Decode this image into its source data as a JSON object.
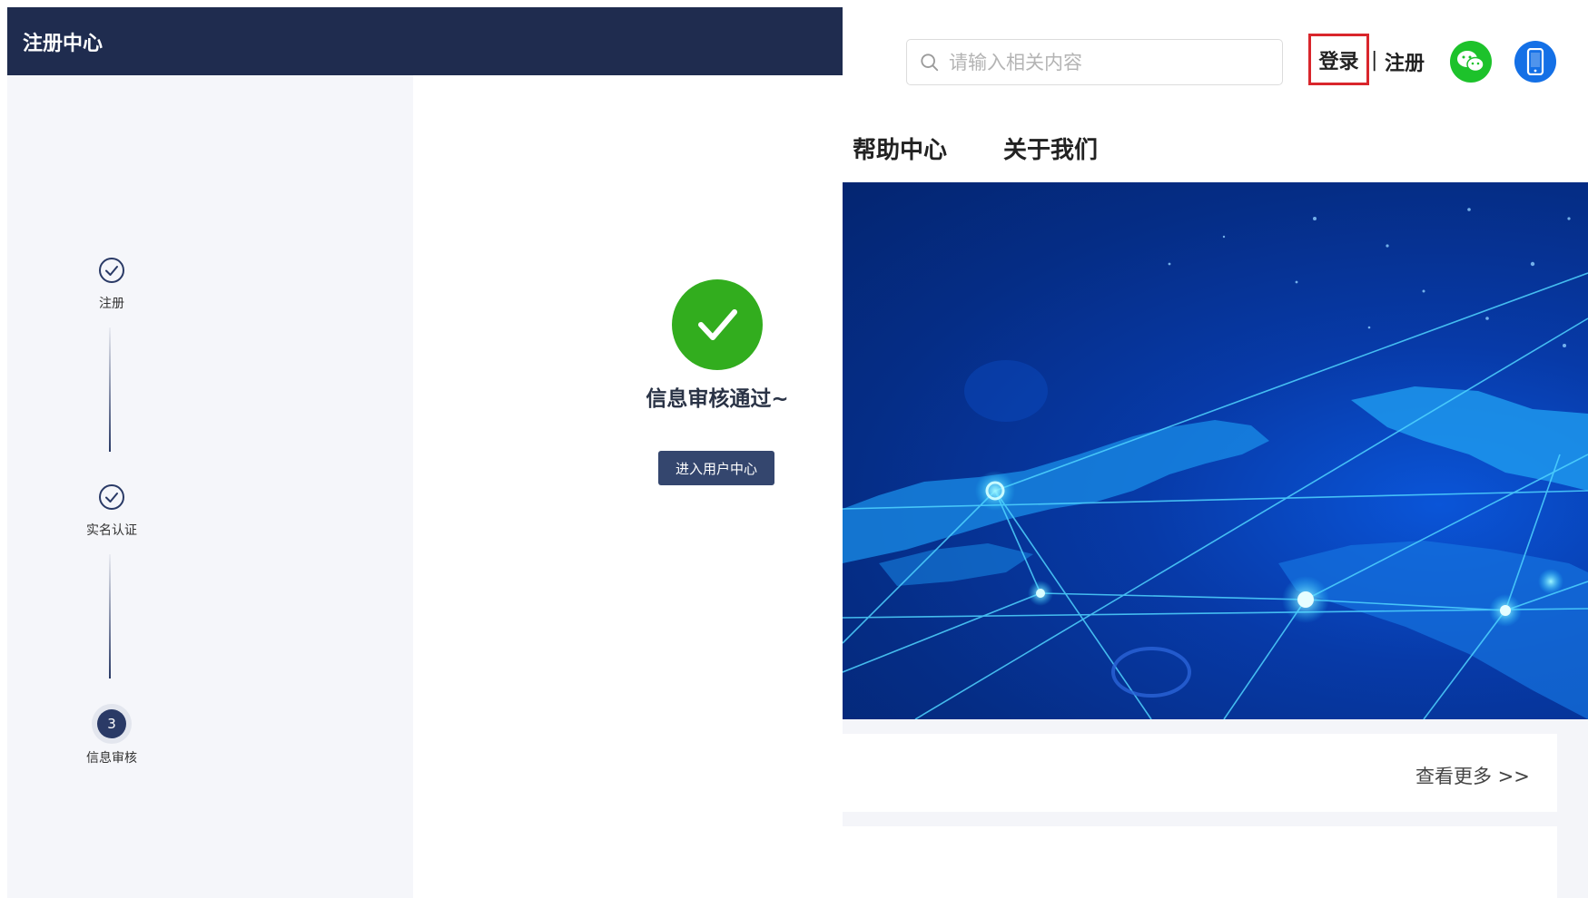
{
  "site": {
    "search": {
      "placeholder": "请输入相关内容",
      "value": ""
    },
    "auth": {
      "login_label": "登录",
      "separator": "|",
      "register_label": "注册"
    },
    "nav": {
      "help_label": "帮助中心",
      "about_label": "关于我们"
    },
    "more_label": "查看更多 >>",
    "icons": {
      "search": "search-icon",
      "wechat": "wechat-icon",
      "mobile": "mobile-icon"
    },
    "colors": {
      "login_highlight": "#d9262c",
      "wechat": "#1dc22b",
      "mobile": "#1470e6"
    }
  },
  "registration": {
    "title": "注册中心",
    "steps": [
      {
        "label": "注册",
        "status": "done",
        "icon": "check-circle-icon"
      },
      {
        "label": "实名认证",
        "status": "done",
        "icon": "check-circle-icon"
      },
      {
        "label": "信息审核",
        "status": "current",
        "number": "3"
      }
    ],
    "result": {
      "message": "信息审核通过~",
      "icon": "success-check-icon",
      "button_label": "进入用户中心"
    },
    "colors": {
      "header": "#1f2c4f",
      "success": "#32ad1e",
      "button": "#34466e"
    }
  }
}
